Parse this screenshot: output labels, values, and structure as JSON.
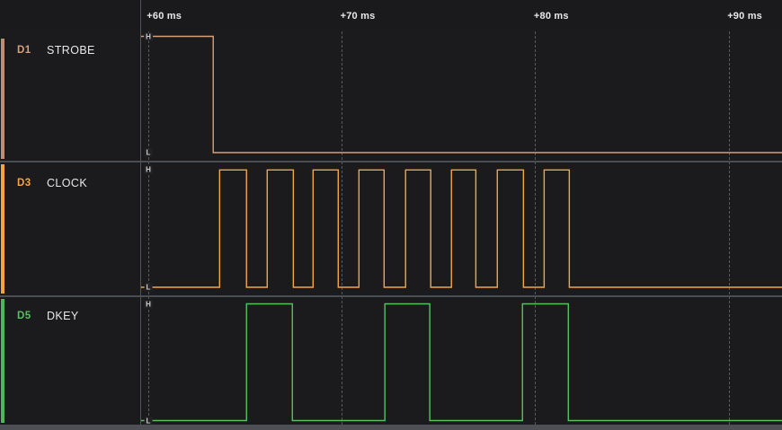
{
  "colors": {
    "background": "#1b1b1d",
    "grid_line": "#56585b",
    "row_separator": "#4a4d51",
    "panel_divider": "#505356",
    "scrollbar_track": "#4c4f53",
    "tick_text": "#e9e9e9",
    "channel_name_text": "#e8e8e8",
    "marker_text": "#cfcfcf"
  },
  "chart_data": {
    "type": "digital-timing",
    "x_unit": "ms",
    "x_range_ms": [
      59.62,
      92.73
    ],
    "grid": true,
    "ticks": [
      {
        "label": "+60 ms",
        "ms": 60
      },
      {
        "label": "+70 ms",
        "ms": 70
      },
      {
        "label": "+80 ms",
        "ms": 80
      },
      {
        "label": "+90 ms",
        "ms": 90
      }
    ],
    "channels": [
      {
        "id": "D1",
        "name": "STROBE",
        "color": "#d8a07b",
        "bar_color": "#c08d74",
        "high_label": "H",
        "low_label": "L",
        "initial_level": "H",
        "edges_ms": [
          63.34
        ]
      },
      {
        "id": "D3",
        "name": "CLOCK",
        "color": "#f4a640",
        "bar_color": "#f5a33b",
        "high_label": "H",
        "low_label": "L",
        "initial_level": "L",
        "edges_ms": [
          63.67,
          65.06,
          66.13,
          67.48,
          68.5,
          69.8,
          70.87,
          72.17,
          73.28,
          74.58,
          75.65,
          76.91,
          78.02,
          79.37,
          80.44,
          81.74
        ]
      },
      {
        "id": "D5",
        "name": "DKEY",
        "color": "#57c05f",
        "bar_color": "#4eb757",
        "high_label": "H",
        "low_label": "L",
        "initial_level": "L",
        "edges_ms": [
          65.06,
          67.43,
          72.21,
          74.53,
          79.32,
          81.69
        ]
      }
    ]
  }
}
